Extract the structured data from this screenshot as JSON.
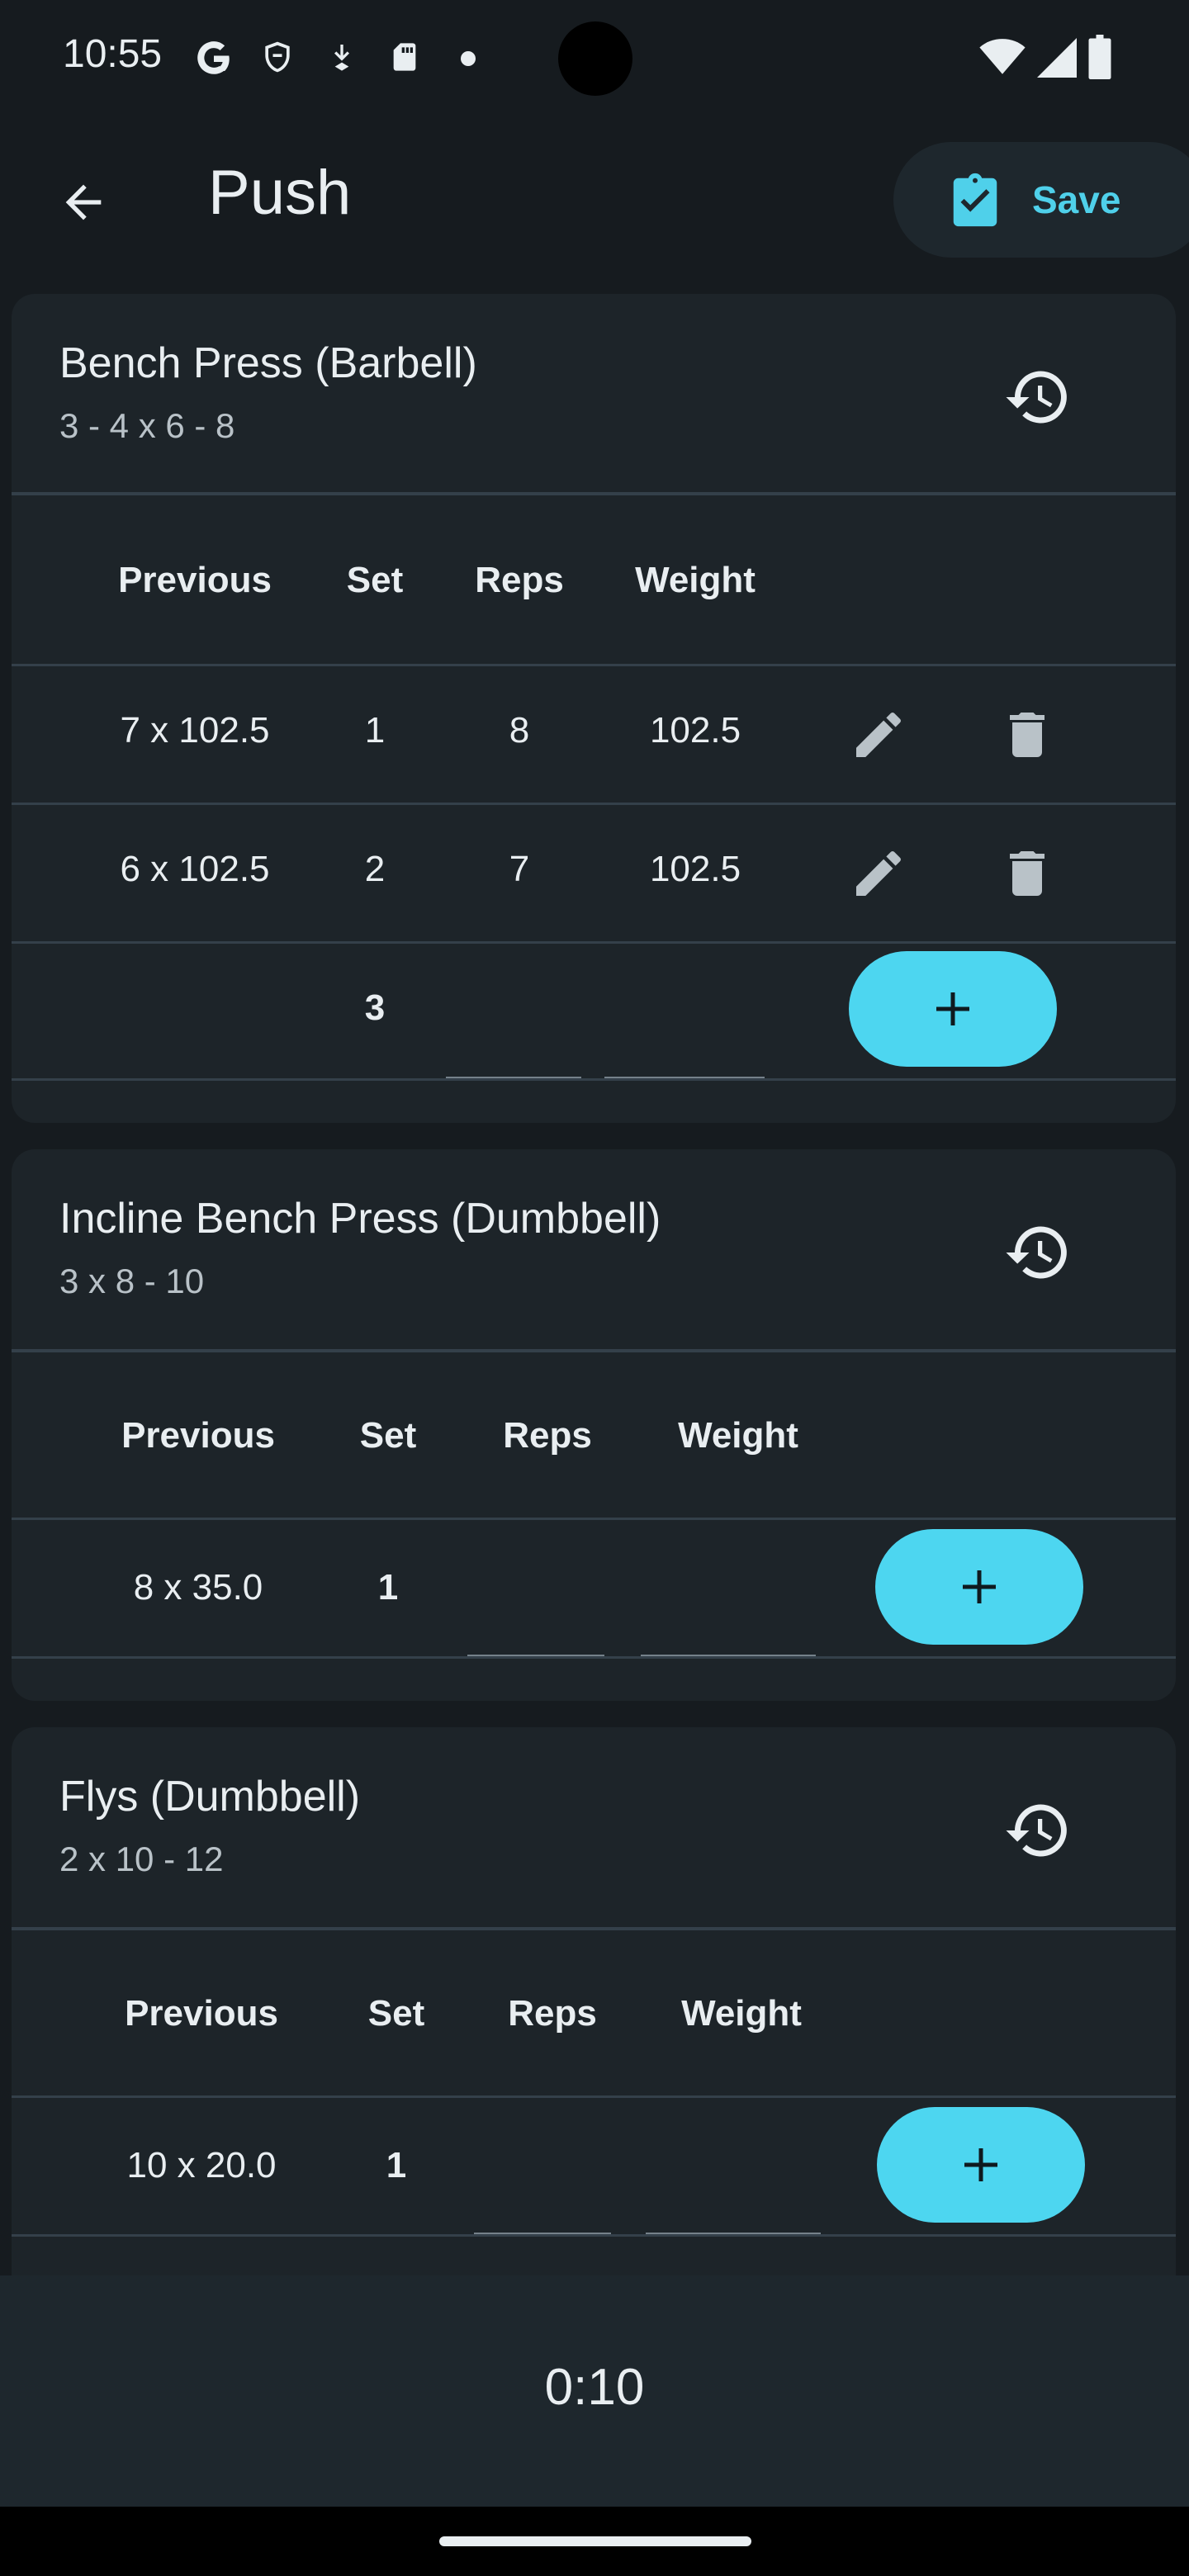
{
  "status_bar": {
    "time": "10:55",
    "icons": [
      "google-icon",
      "shield-icon",
      "download-icon",
      "sd-card-icon",
      "dot-icon",
      "wifi-icon",
      "signal-icon",
      "battery-icon"
    ]
  },
  "app_bar": {
    "back_icon": "arrow-back-icon",
    "title": "Push",
    "save_label": "Save",
    "save_icon": "clipboard-check-icon",
    "accent": "#4fd0ea"
  },
  "table_headers": {
    "previous": "Previous",
    "set": "Set",
    "reps": "Reps",
    "weight": "Weight"
  },
  "exercises": [
    {
      "name": "Bench Press (Barbell)",
      "scheme": "3 - 4 x 6 - 8",
      "sets": [
        {
          "previous": "7 x 102.5",
          "set": "1",
          "reps": "8",
          "weight": "102.5"
        },
        {
          "previous": "6 x 102.5",
          "set": "2",
          "reps": "7",
          "weight": "102.5"
        }
      ],
      "new_set": {
        "set": "3"
      }
    },
    {
      "name": "Incline Bench Press (Dumbbell)",
      "scheme": "3 x 8 - 10",
      "sets": [],
      "new_set": {
        "previous": "8 x 35.0",
        "set": "1"
      }
    },
    {
      "name": "Flys (Dumbbell)",
      "scheme": "2 x 10 - 12",
      "sets": [],
      "new_set": {
        "previous": "10 x 20.0",
        "set": "1"
      }
    }
  ],
  "rest_timer": "0:10",
  "colors": {
    "background": "#161b1f",
    "card": "#1d2429",
    "add_button": "#4dd6f0"
  }
}
